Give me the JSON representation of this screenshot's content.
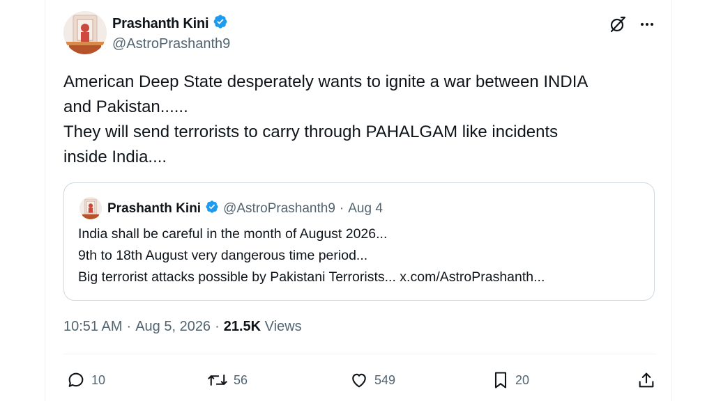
{
  "tweet": {
    "author": {
      "name": "Prashanth Kini",
      "handle": "@AstroPrashanth9",
      "verified": true
    },
    "text_lines": [
      "American Deep State desperately wants to ignite a war between INDIA",
      "and Pakistan......",
      "They will send terrorists to carry through PAHALGAM like incidents",
      "inside India...."
    ],
    "time": "10:51 AM",
    "date": "Aug 5, 2026",
    "views_count": "21.5K",
    "views_label": "Views",
    "separator": "·"
  },
  "quoted": {
    "name": "Prashanth Kini",
    "handle": "@AstroPrashanth9",
    "date": "Aug 4",
    "separator": "·",
    "lines": [
      "India shall be careful in the month of August 2026...",
      "9th to 18th August very dangerous time period...",
      "Big terrorist attacks possible by Pakistani Terrorists... x.com/AstroPrashanth..."
    ]
  },
  "actions": {
    "replies": "10",
    "reposts": "56",
    "likes": "549",
    "bookmarks": "20"
  },
  "icons": {
    "grok": "grok-icon",
    "more": "more-icon",
    "verified": "verified-badge-icon",
    "reply": "reply-icon",
    "repost": "repost-icon",
    "like": "like-icon",
    "bookmark": "bookmark-icon",
    "share": "share-icon"
  },
  "colors": {
    "verified": "#1d9bf0",
    "text": "#0f1419",
    "secondary": "#536471",
    "border": "#cfd9de"
  }
}
